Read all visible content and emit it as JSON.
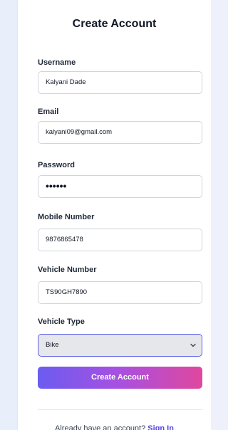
{
  "form": {
    "title": "Create Account",
    "username": {
      "label": "Username",
      "value": "Kalyani Dade"
    },
    "email": {
      "label": "Email",
      "value": "kalyani09@gmail.com"
    },
    "password": {
      "label": "Password",
      "masked_value": "••••••"
    },
    "mobile": {
      "label": "Mobile Number",
      "value": "9876865478"
    },
    "vehicle_number": {
      "label": "Vehicle Number",
      "value": "TS90GH7890"
    },
    "vehicle_type": {
      "label": "Vehicle Type",
      "selected": "Bike"
    },
    "submit_label": "Create Account"
  },
  "footer": {
    "prompt": "Already have an account?",
    "link": "Sign In"
  },
  "colors": {
    "accent": "#5b5fe6",
    "gradient_start": "#6b5cf0",
    "gradient_end": "#e0479e",
    "link": "#4f46e5"
  },
  "icons": {
    "select_chevron": "chevron-down-icon"
  }
}
